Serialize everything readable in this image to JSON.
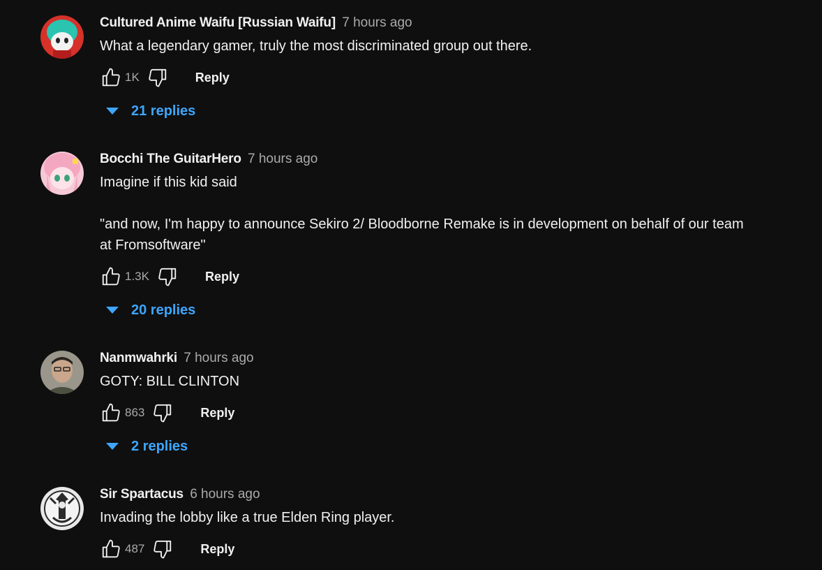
{
  "comments": [
    {
      "author": "Cultured Anime Waifu [Russian Waifu]",
      "time": "7 hours ago",
      "text": "What a legendary gamer, truly the most discriminated group out there.",
      "likes": "1K",
      "reply_label": "Reply",
      "replies_label": "21 replies",
      "avatar_colors": [
        "#d6322a",
        "#2ac4b0"
      ]
    },
    {
      "author": "Bocchi The GuitarHero",
      "time": "7 hours ago",
      "text": "Imagine if this kid said\n\n\"and now, I'm happy to announce Sekiro 2/ Bloodborne Remake is in development on behalf of our team at Fromsoftware\"",
      "likes": "1.3K",
      "reply_label": "Reply",
      "replies_label": "20 replies",
      "avatar_colors": [
        "#f4a7c0",
        "#fde2ea"
      ]
    },
    {
      "author": "Nanmwahrki",
      "time": "7 hours ago",
      "text": "GOTY: BILL CLINTON",
      "likes": "863",
      "reply_label": "Reply",
      "replies_label": "2 replies",
      "avatar_colors": [
        "#b59a84",
        "#4b5040"
      ]
    },
    {
      "author": "Sir Spartacus",
      "time": "6 hours ago",
      "text": "Invading the lobby like a true Elden Ring player.",
      "likes": "487",
      "reply_label": "Reply",
      "avatar_colors": [
        "#e8e8e8",
        "#2b2b2b"
      ]
    }
  ]
}
